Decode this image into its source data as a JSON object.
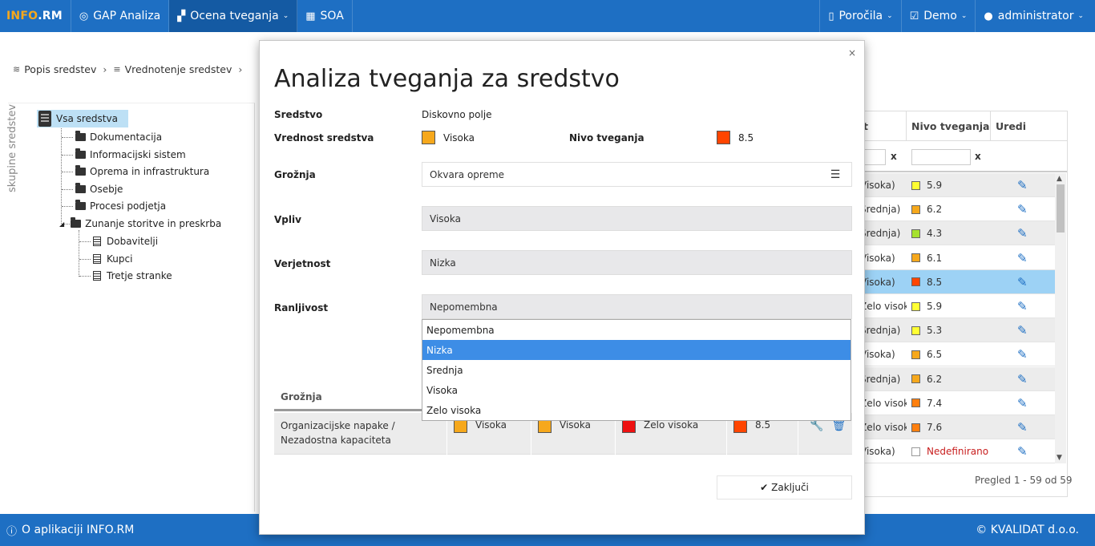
{
  "navbar": {
    "brand_part1": "INFO",
    "brand_part2": ".RM",
    "items": [
      {
        "label": "GAP Analiza"
      },
      {
        "label": "Ocena tveganja"
      },
      {
        "label": "SOA"
      }
    ],
    "right_items": [
      {
        "label": "Poročila"
      },
      {
        "label": "Demo"
      },
      {
        "label": "administrator"
      }
    ],
    "colors": {
      "bar": "#1e6fc3",
      "active": "#145aa3",
      "brand_accent": "#f6a81c"
    }
  },
  "breadcrumb": {
    "items": [
      "Popis sredstev",
      "Vrednotenje sredstev"
    ]
  },
  "sidebar": {
    "vertical_label": "skupine sredstev",
    "root": "Vsa sredstva",
    "folders": [
      "Dokumentacija",
      "Informacijski sistem",
      "Oprema in infrastruktura",
      "Osebje",
      "Procesi podjetja",
      "Zunanje storitve in preskrba"
    ],
    "children": [
      "Dobavitelji",
      "Kupci",
      "Tretje stranke"
    ]
  },
  "table": {
    "headers": {
      "col1_partial": "t",
      "risk": "Nivo tveganja",
      "edit": "Uredi"
    },
    "filter_clear": "x",
    "rows": [
      {
        "partial": "Visoka)",
        "color": "#ffff33",
        "value": "5.9"
      },
      {
        "partial": "Srednja)",
        "color": "#f6a81c",
        "value": "6.2"
      },
      {
        "partial": "Srednja)",
        "color": "#a6e22e",
        "value": "4.3"
      },
      {
        "partial": "Visoka)",
        "color": "#f6a81c",
        "value": "6.1"
      },
      {
        "partial": "Visoka)",
        "color": "#ff4500",
        "value": "8.5"
      },
      {
        "partial": "Zelo visok",
        "color": "#ffff33",
        "value": "5.9"
      },
      {
        "partial": "Srednja)",
        "color": "#ffff33",
        "value": "5.3"
      },
      {
        "partial": "Visoka)",
        "color": "#f6a81c",
        "value": "6.5"
      },
      {
        "partial": "Srednja)",
        "color": "#f6a81c",
        "value": "6.2"
      },
      {
        "partial": "Zelo visok",
        "color": "#ff7f0e",
        "value": "7.4"
      },
      {
        "partial": "Zelo visok",
        "color": "#ff7f0e",
        "value": "7.6"
      },
      {
        "partial": "Visoka)",
        "color": "#ffffff",
        "value": "Nedefinirano"
      }
    ],
    "pager": "Pregled 1 - 59 od 59"
  },
  "footer": {
    "about": "O aplikaciji INFO.RM",
    "copyright": "© KVALIDAT d.o.o."
  },
  "modal": {
    "close": "×",
    "title": "Analiza tveganja za sredstvo",
    "asset_label": "Sredstvo",
    "asset_value": "Diskovno polje",
    "asset_value_label": "Vrednost sredstva",
    "asset_value_text": "Visoka",
    "asset_value_color": "#f6a81c",
    "risk_level_label": "Nivo tveganja",
    "risk_level_value": "8.5",
    "risk_level_color": "#ff4500",
    "threat_label": "Grožnja",
    "threat_value": "Okvara opreme",
    "impact_label": "Vpliv",
    "impact_value": "Visoka",
    "probability_label": "Verjetnost",
    "probability_value": "Nizka",
    "vulnerability_label": "Ranljivost",
    "vulnerability_value": "Nepomembna",
    "vulnerability_options": [
      "Nepomembna",
      "Nizka",
      "Srednja",
      "Visoka",
      "Zelo visoka"
    ],
    "vulnerability_highlighted": "Nizka",
    "inner_table": {
      "header": "Grožnja",
      "row": {
        "threat": "Organizacijske napake / Nezadostna kapaciteta",
        "c1_text": "Visoka",
        "c1_color": "#f6a81c",
        "c2_text": "Visoka",
        "c2_color": "#f6a81c",
        "c3_text": "Zelo visoka",
        "c3_color": "#ee1111",
        "risk_text": "8.5",
        "risk_color": "#ff4500"
      }
    },
    "close_button": "Zaključi"
  }
}
